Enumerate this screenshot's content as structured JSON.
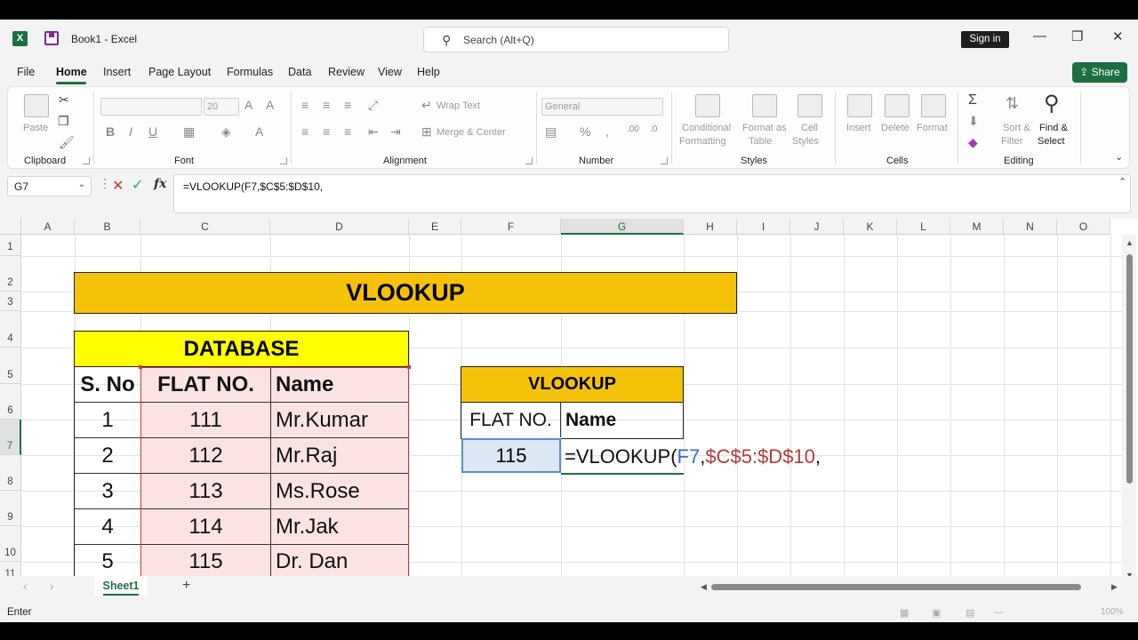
{
  "window": {
    "app_icon": "excel-icon",
    "title": "Book1  -  Excel",
    "search_placeholder": "Search (Alt+Q)",
    "signin_label": "Sign in",
    "minimize": "—",
    "maximize": "❐",
    "close": "✕"
  },
  "menu": {
    "tabs": [
      "File",
      "Home",
      "Insert",
      "Page Layout",
      "Formulas",
      "Data",
      "Review",
      "View",
      "Help"
    ],
    "active": "Home",
    "share_label": "Share"
  },
  "ribbon": {
    "clipboard": {
      "label": "Clipboard",
      "paste": "Paste"
    },
    "font": {
      "label": "Font",
      "size": "20"
    },
    "alignment": {
      "label": "Alignment",
      "wrap": "Wrap Text",
      "merge": "Merge & Center"
    },
    "number": {
      "label": "Number",
      "format": "General"
    },
    "styles": {
      "label": "Styles",
      "cond1": "Conditional",
      "cond2": "Formatting",
      "fmt1": "Format as",
      "fmt2": "Table",
      "cell1": "Cell",
      "cell2": "Styles"
    },
    "cells": {
      "label": "Cells",
      "insert": "Insert",
      "delete": "Delete",
      "format": "Format"
    },
    "editing": {
      "label": "Editing",
      "sort1": "Sort &",
      "sort2": "Filter",
      "find1": "Find &",
      "find2": "Select"
    }
  },
  "formula_bar": {
    "name_box": "G7",
    "formula": "=VLOOKUP(F7,$C$5:$D$10,"
  },
  "columns": [
    "A",
    "B",
    "C",
    "D",
    "E",
    "F",
    "G",
    "H",
    "I",
    "J",
    "K",
    "L",
    "M",
    "N",
    "O"
  ],
  "rows": [
    "1",
    "2",
    "3",
    "4",
    "5",
    "6",
    "7",
    "8",
    "9",
    "10",
    "11"
  ],
  "selected_column": "G",
  "selected_row": "7",
  "sheet": {
    "banner": "VLOOKUP",
    "database_title": "DATABASE",
    "headers": [
      "S. No",
      "FLAT NO.",
      "Name"
    ],
    "records": [
      [
        "1",
        "111",
        "Mr.Kumar"
      ],
      [
        "2",
        "112",
        "Mr.Raj"
      ],
      [
        "3",
        "113",
        "Ms.Rose"
      ],
      [
        "4",
        "114",
        "Mr.Jak"
      ],
      [
        "5",
        "115",
        "Dr. Dan"
      ]
    ],
    "lookup_title": "VLOOKUP",
    "lookup_headers": [
      "FLAT NO.",
      "Name"
    ],
    "lookup_value": "115",
    "formula_parts": {
      "p1": "=VLOOKUP(",
      "p2": "F7",
      "p3": ",",
      "p4": "$C$5:$D$10",
      "p5": ","
    }
  },
  "sheet_tabs": {
    "active": "Sheet1",
    "add": "+"
  },
  "status": {
    "mode": "Enter",
    "zoom": "100%"
  },
  "colors": {
    "accent": "#1d6f42",
    "banner": "#f5c20a",
    "db_header": "#ffff00",
    "pink": "#fbe3e3",
    "ref_blue": "#3a6fb5",
    "ref_red": "#b33a3a"
  }
}
